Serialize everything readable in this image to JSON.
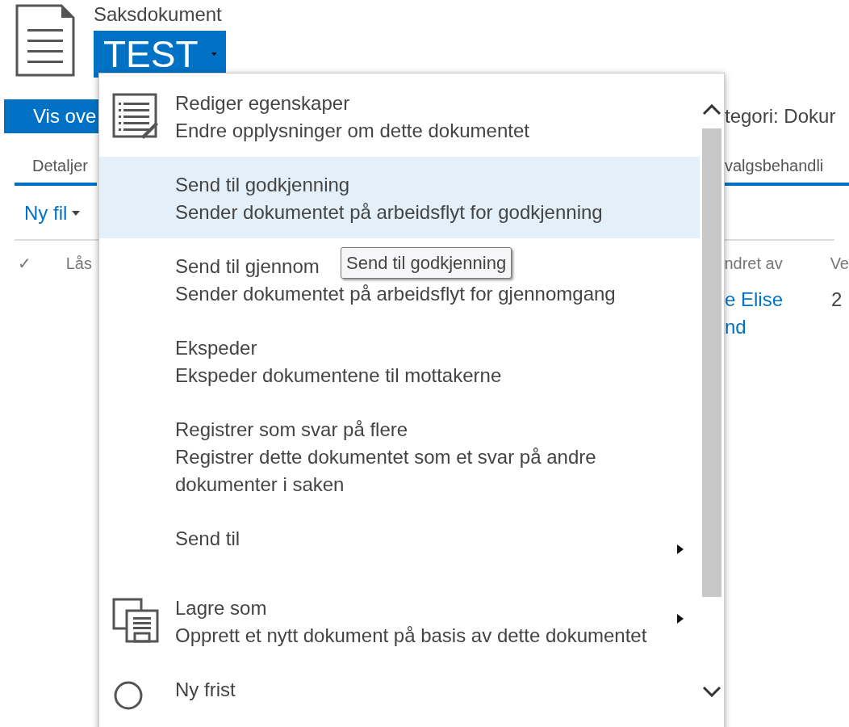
{
  "header": {
    "content_type": "Saksdokument",
    "title": "TEST"
  },
  "view_button": "Vis ove",
  "category": "tegori: Dokur",
  "tabs": [
    {
      "label": "Detaljer",
      "selected": true
    },
    {
      "label": "valgsbehandli",
      "selected": true
    }
  ],
  "new_file": "Ny fil",
  "table": {
    "columns": [
      "✓",
      "Lås",
      "ndret av",
      "Ve"
    ],
    "rows": [
      {
        "changed_by": "e Elise nd",
        "version": "2"
      }
    ]
  },
  "menu": {
    "items": [
      {
        "title": "Rediger egenskaper",
        "description": "Endre opplysninger om dette dokumentet",
        "kind": "edit",
        "selected": false,
        "submenu": false
      },
      {
        "title": "Send til godkjenning",
        "description": "Sender dokumentet på arbeidsflyt for godkjenning",
        "kind": "plain",
        "selected": true,
        "submenu": false
      },
      {
        "title": "Send til gjennom",
        "description": "Sender dokumentet på arbeidsflyt for gjennomgang",
        "kind": "plain",
        "selected": false,
        "submenu": false
      },
      {
        "title": "Ekspeder",
        "description": "Ekspeder dokumentene til mottakerne",
        "kind": "plain",
        "selected": false,
        "submenu": false
      },
      {
        "title": "Registrer som svar på flere",
        "description": "Registrer dette dokumentet som et svar på andre dokumenter i saken",
        "kind": "plain",
        "selected": false,
        "submenu": false
      },
      {
        "title": "Send til",
        "kind": "plain",
        "selected": false,
        "submenu": true
      },
      {
        "title": "Lagre som",
        "description": "Opprett et nytt dokument på basis av dette dokumentet",
        "kind": "save",
        "selected": false,
        "submenu": true
      },
      {
        "title": "Ny frist",
        "kind": "clock",
        "selected": false,
        "submenu": false
      }
    ]
  },
  "tooltip": {
    "text": "Send til godkjenning"
  }
}
